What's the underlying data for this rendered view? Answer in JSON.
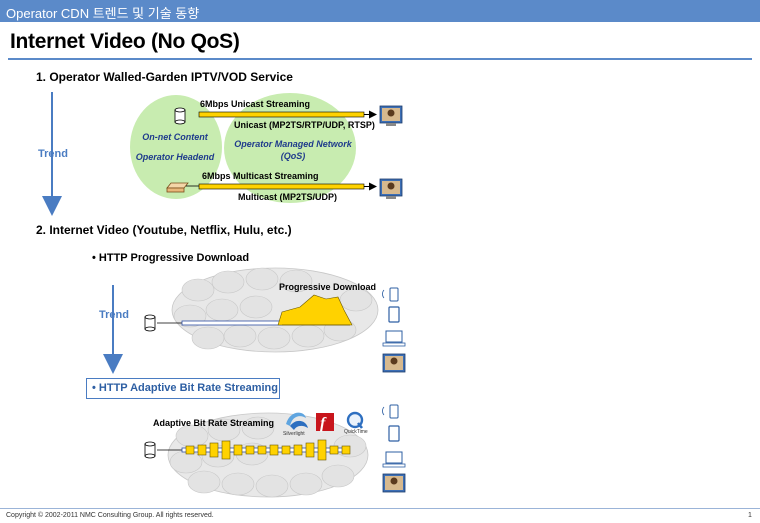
{
  "header": {
    "title": "Operator CDN 트렌드 및 기술 동향"
  },
  "slide": {
    "title": "Internet Video (No QoS)"
  },
  "section1": {
    "heading": "1. Operator Walled-Garden IPTV/VOD Service",
    "unicast_label": "6Mbps Unicast Streaming",
    "unicast_protocols": "Unicast (MP2TS/RTP/UDP, RTSP)",
    "multicast_label": "6Mbps Multicast Streaming",
    "multicast_protocols": "Multicast (MP2TS/UDP)",
    "left_oval_line1": "On-net Content",
    "left_oval_line2": "Operator Headend",
    "right_oval_line1": "Operator Managed Network",
    "right_oval_line2": "(QoS)",
    "trend": "Trend"
  },
  "section2": {
    "heading": "2. Internet Video (Youtube, Netflix, Hulu, etc.)",
    "bullet_progressive": "• HTTP Progressive Download",
    "progressive_label": "Progressive Download",
    "trend": "Trend",
    "bullet_abr": "• HTTP Adaptive Bit Rate Streaming",
    "abr_label": "Adaptive Bit Rate Streaming",
    "logos": {
      "silverlight": "Silverlight",
      "quicktime": "QuickTime"
    }
  },
  "footer": {
    "copyright": "Copyright © 2002-2011 NMC Consulting Group. All rights reserved.",
    "page": "1"
  },
  "colors": {
    "accent": "#5b8ac9",
    "green_oval": "#c8ecb0",
    "stream_fill": "#ffd200",
    "cloud": "#e3e3e3"
  }
}
